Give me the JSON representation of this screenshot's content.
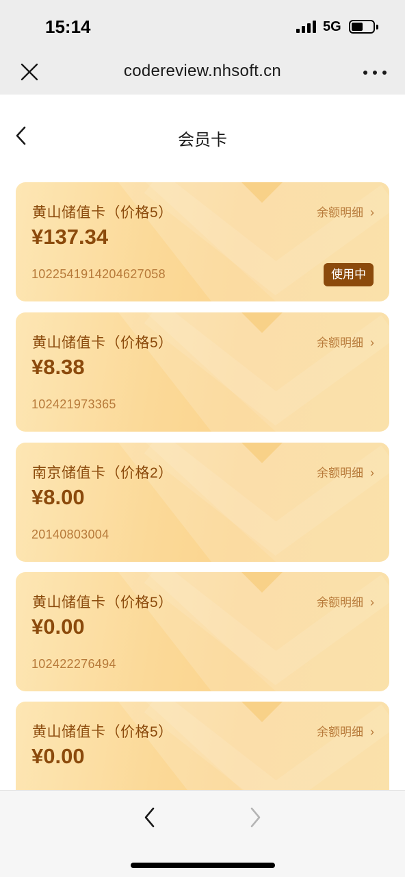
{
  "status_bar": {
    "time": "15:14",
    "network": "5G",
    "icons": [
      "signal-icon",
      "battery-icon"
    ]
  },
  "browser": {
    "url": "codereview.nhsoft.cn",
    "icons": [
      "close-icon",
      "more-icon"
    ]
  },
  "header": {
    "title": "会员卡",
    "back_icon": "chevron-left-icon"
  },
  "cards": [
    {
      "name": "黄山储值卡（价格5）",
      "balance": "¥137.34",
      "number": "1022541914204627058",
      "detail_label": "余额明细",
      "badge": "使用中"
    },
    {
      "name": "黄山储值卡（价格5）",
      "balance": "¥8.38",
      "number": "102421973365",
      "detail_label": "余额明细"
    },
    {
      "name": "南京储值卡（价格2）",
      "balance": "¥8.00",
      "number": "20140803004",
      "detail_label": "余额明细"
    },
    {
      "name": "黄山储值卡（价格5）",
      "balance": "¥0.00",
      "number": "102422276494",
      "detail_label": "余额明细"
    },
    {
      "name": "黄山储值卡（价格5）",
      "balance": "¥0.00",
      "number": "",
      "detail_label": "余额明细"
    }
  ],
  "bottom_nav": {
    "back_icon": "chevron-left-icon",
    "forward_icon": "chevron-right-icon"
  },
  "colors": {
    "brand_brown": "#8b4a0c",
    "card_gold": "#fbd894",
    "muted_text": "#b77a3a",
    "chrome_gray": "#ededed"
  }
}
